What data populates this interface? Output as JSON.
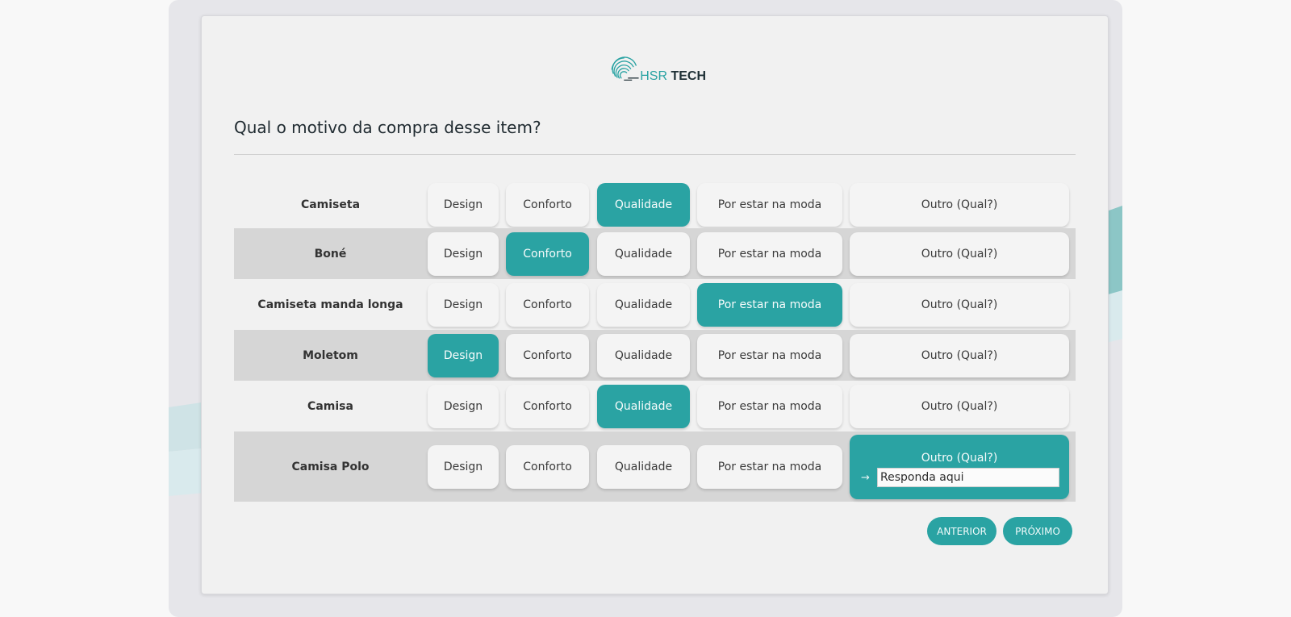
{
  "logo": {
    "hsr": "HSR",
    "tech": " TECH"
  },
  "question": "Qual o motivo da compra desse item?",
  "options": [
    "Design",
    "Conforto",
    "Qualidade",
    "Por estar na moda",
    "Outro (Qual?)"
  ],
  "rows": [
    {
      "label": "Camiseta",
      "selected": 2
    },
    {
      "label": "Boné",
      "selected": 1
    },
    {
      "label": "Camiseta manda longa",
      "selected": 3
    },
    {
      "label": "Moletom",
      "selected": 0
    },
    {
      "label": "Camisa",
      "selected": 2
    },
    {
      "label": "Camisa Polo",
      "selected": 4
    }
  ],
  "other_input": {
    "value": "Responda aqui",
    "arrow": "→"
  },
  "buttons": {
    "previous": "ANTERIOR",
    "next": "PRÓXIMO"
  },
  "colors": {
    "accent": "#2aa3a3",
    "shaded_row": "#d6d6d6",
    "card": "#f1f1f1"
  }
}
